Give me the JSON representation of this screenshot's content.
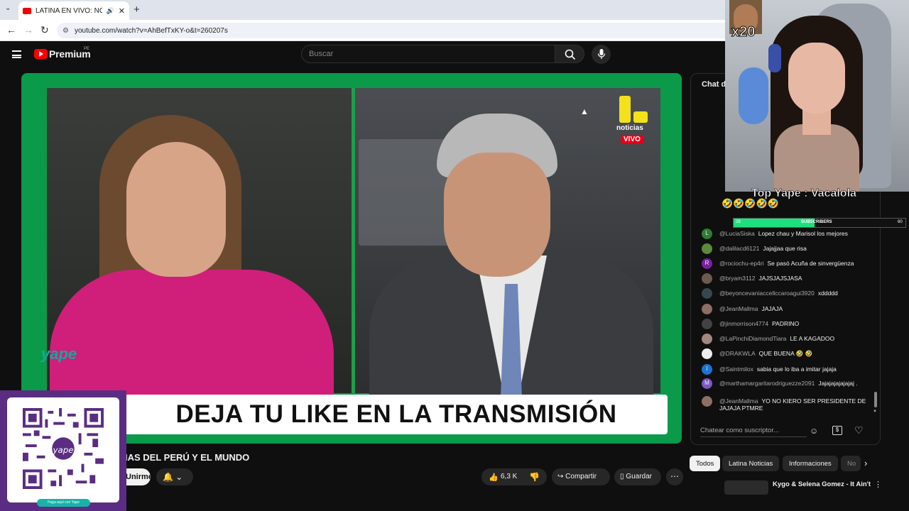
{
  "browser": {
    "tab_title": "LATINA EN VIVO: NOTICIAS",
    "url": "youtube.com/watch?v=AhBefTxKY-o&t=260207s",
    "new_tab_symbol": "+",
    "close_symbol": "✕"
  },
  "youtube": {
    "brand": "Premium",
    "region": "PE",
    "search_placeholder": "Buscar"
  },
  "video": {
    "channel_logo_text": "noticias",
    "live_badge": "VIVO",
    "banner_text": "DEJA TU LIKE EN LA TRANSMISIÓN",
    "title_visible": "IAS DEL PERÚ Y EL MUNDO",
    "join_label": "Unirme",
    "likes": "6,3 K",
    "share_label": "Compartir",
    "save_label": "Guardar"
  },
  "overlay": {
    "yape_brand": "yape",
    "qr_footer": "Paga aquí con Yape",
    "top_yape": "Top Yape : Vacalola",
    "top_yape_emojis": "🤣🤣🤣🤣🤣",
    "emote_multiplier": "x20",
    "subs_current": "28",
    "subs_label": "SUBSCRIBERS",
    "subs_goal": "60",
    "subs_progress": 0.47
  },
  "chat": {
    "header": "Chat de",
    "input_placeholder": "Chatear como suscriptor...",
    "messages": [
      {
        "author": "@LuciaSiska",
        "text": "Lopez chau y Marisol los mejores",
        "avatar_color": "#2e7d32",
        "initial": "L"
      },
      {
        "author": "@dalilacd6121",
        "text": "Jajajjaa que risa",
        "avatar_color": "#5d8a3a",
        "initial": ""
      },
      {
        "author": "@rociochu-ep4ri",
        "text": "Se pasó Acuña de sinvergüenza",
        "avatar_color": "#7b1fa2",
        "initial": "R"
      },
      {
        "author": "@bryam3112",
        "text": "JAJSJAJSJASA",
        "avatar_color": "#6d5a4e",
        "initial": ""
      },
      {
        "author": "@beyoncevaniaccellccaroagui3920",
        "text": "xddddd",
        "avatar_color": "#37474f",
        "initial": ""
      },
      {
        "author": "@JeanMallma",
        "text": "JAJAJA",
        "avatar_color": "#8d6e63",
        "initial": ""
      },
      {
        "author": "@jinmorrison4774",
        "text": "PADRINO",
        "avatar_color": "#424242",
        "initial": ""
      },
      {
        "author": "@LaPinchiDiamondTiara",
        "text": "LE A KAGADOO",
        "avatar_color": "#a1887f",
        "initial": ""
      },
      {
        "author": "@DRAKWLA",
        "text": "QUE BUENA 🤣 🤣",
        "avatar_color": "#eeeeee",
        "initial": ""
      },
      {
        "author": "@Saintmilox",
        "text": "sabia que lo iba a imitar jajaja",
        "avatar_color": "#1976d2",
        "initial": "I"
      },
      {
        "author": "@marthamargaritarodriguezze2091",
        "text": "Jajajajajajajaj .",
        "avatar_color": "#7e57c2",
        "initial": "M"
      },
      {
        "author": "@JeanMallma",
        "text": "YO NO KIERO SER PRESIDENTE DE JAJAJA PTMRE",
        "avatar_color": "#8d6e63",
        "initial": ""
      }
    ]
  },
  "chips": [
    "Todos",
    "Latina Noticias",
    "Informaciones",
    "No"
  ],
  "up_next_title": "Kygo & Selena Gomez - It Ain't"
}
